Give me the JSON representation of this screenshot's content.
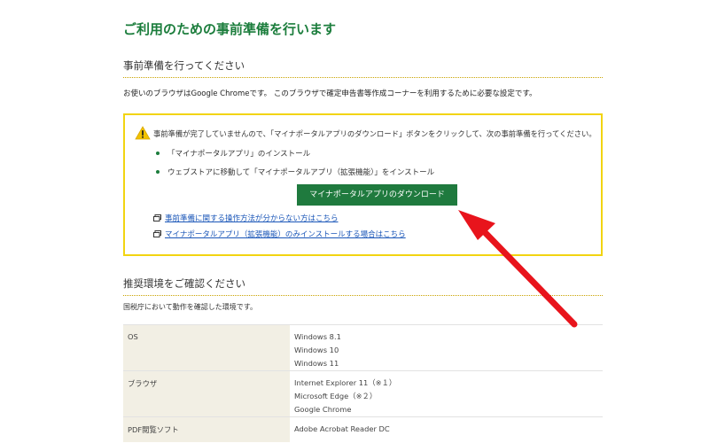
{
  "header": {
    "title": "ご利用のための事前準備を行います"
  },
  "prep_section": {
    "heading": "事前準備を行ってください",
    "intro": "お使いのブラウザはGoogle Chromeです。 このブラウザで確定申告書等作成コーナーを利用するために必要な設定です。"
  },
  "notice": {
    "message": "事前準備が完了していませんので、「マイナポータルアプリのダウンロード」ボタンをクリックして、次の事前準備を行ってください。",
    "steps": [
      "「マイナポータルアプリ」のインストール",
      "ウェブストアに移動して「マイナポータルアプリ（拡張機能）」をインストール"
    ],
    "download_button_label": "マイナポータルアプリのダウンロード",
    "links": [
      "事前準備に関する操作方法が分からない方はこちら",
      "マイナポータルアプリ（拡張機能）のみインストールする場合はこちら"
    ],
    "icon_warning": "warning-icon",
    "icon_external": "external-window-icon"
  },
  "env_section": {
    "heading": "推奨環境をご確認ください",
    "intro": "国税庁において動作を確認した環境です。",
    "rows": [
      {
        "label": "OS",
        "values": [
          "Windows 8.1",
          "Windows 10",
          "Windows 11"
        ]
      },
      {
        "label": "ブラウザ",
        "values": [
          "Internet Explorer 11（※１）",
          "Microsoft Edge（※２）",
          "Google Chrome"
        ]
      },
      {
        "label": "PDF閲覧ソフト",
        "values": [
          "Adobe Acrobat Reader DC"
        ]
      }
    ]
  },
  "colors": {
    "title_green": "#1b7d3c",
    "button_green": "#1f7a3e",
    "notice_border": "#f2d411",
    "link_blue": "#1a56b8",
    "arrow_red": "#e8141c",
    "table_label_bg": "#f2efe4"
  }
}
